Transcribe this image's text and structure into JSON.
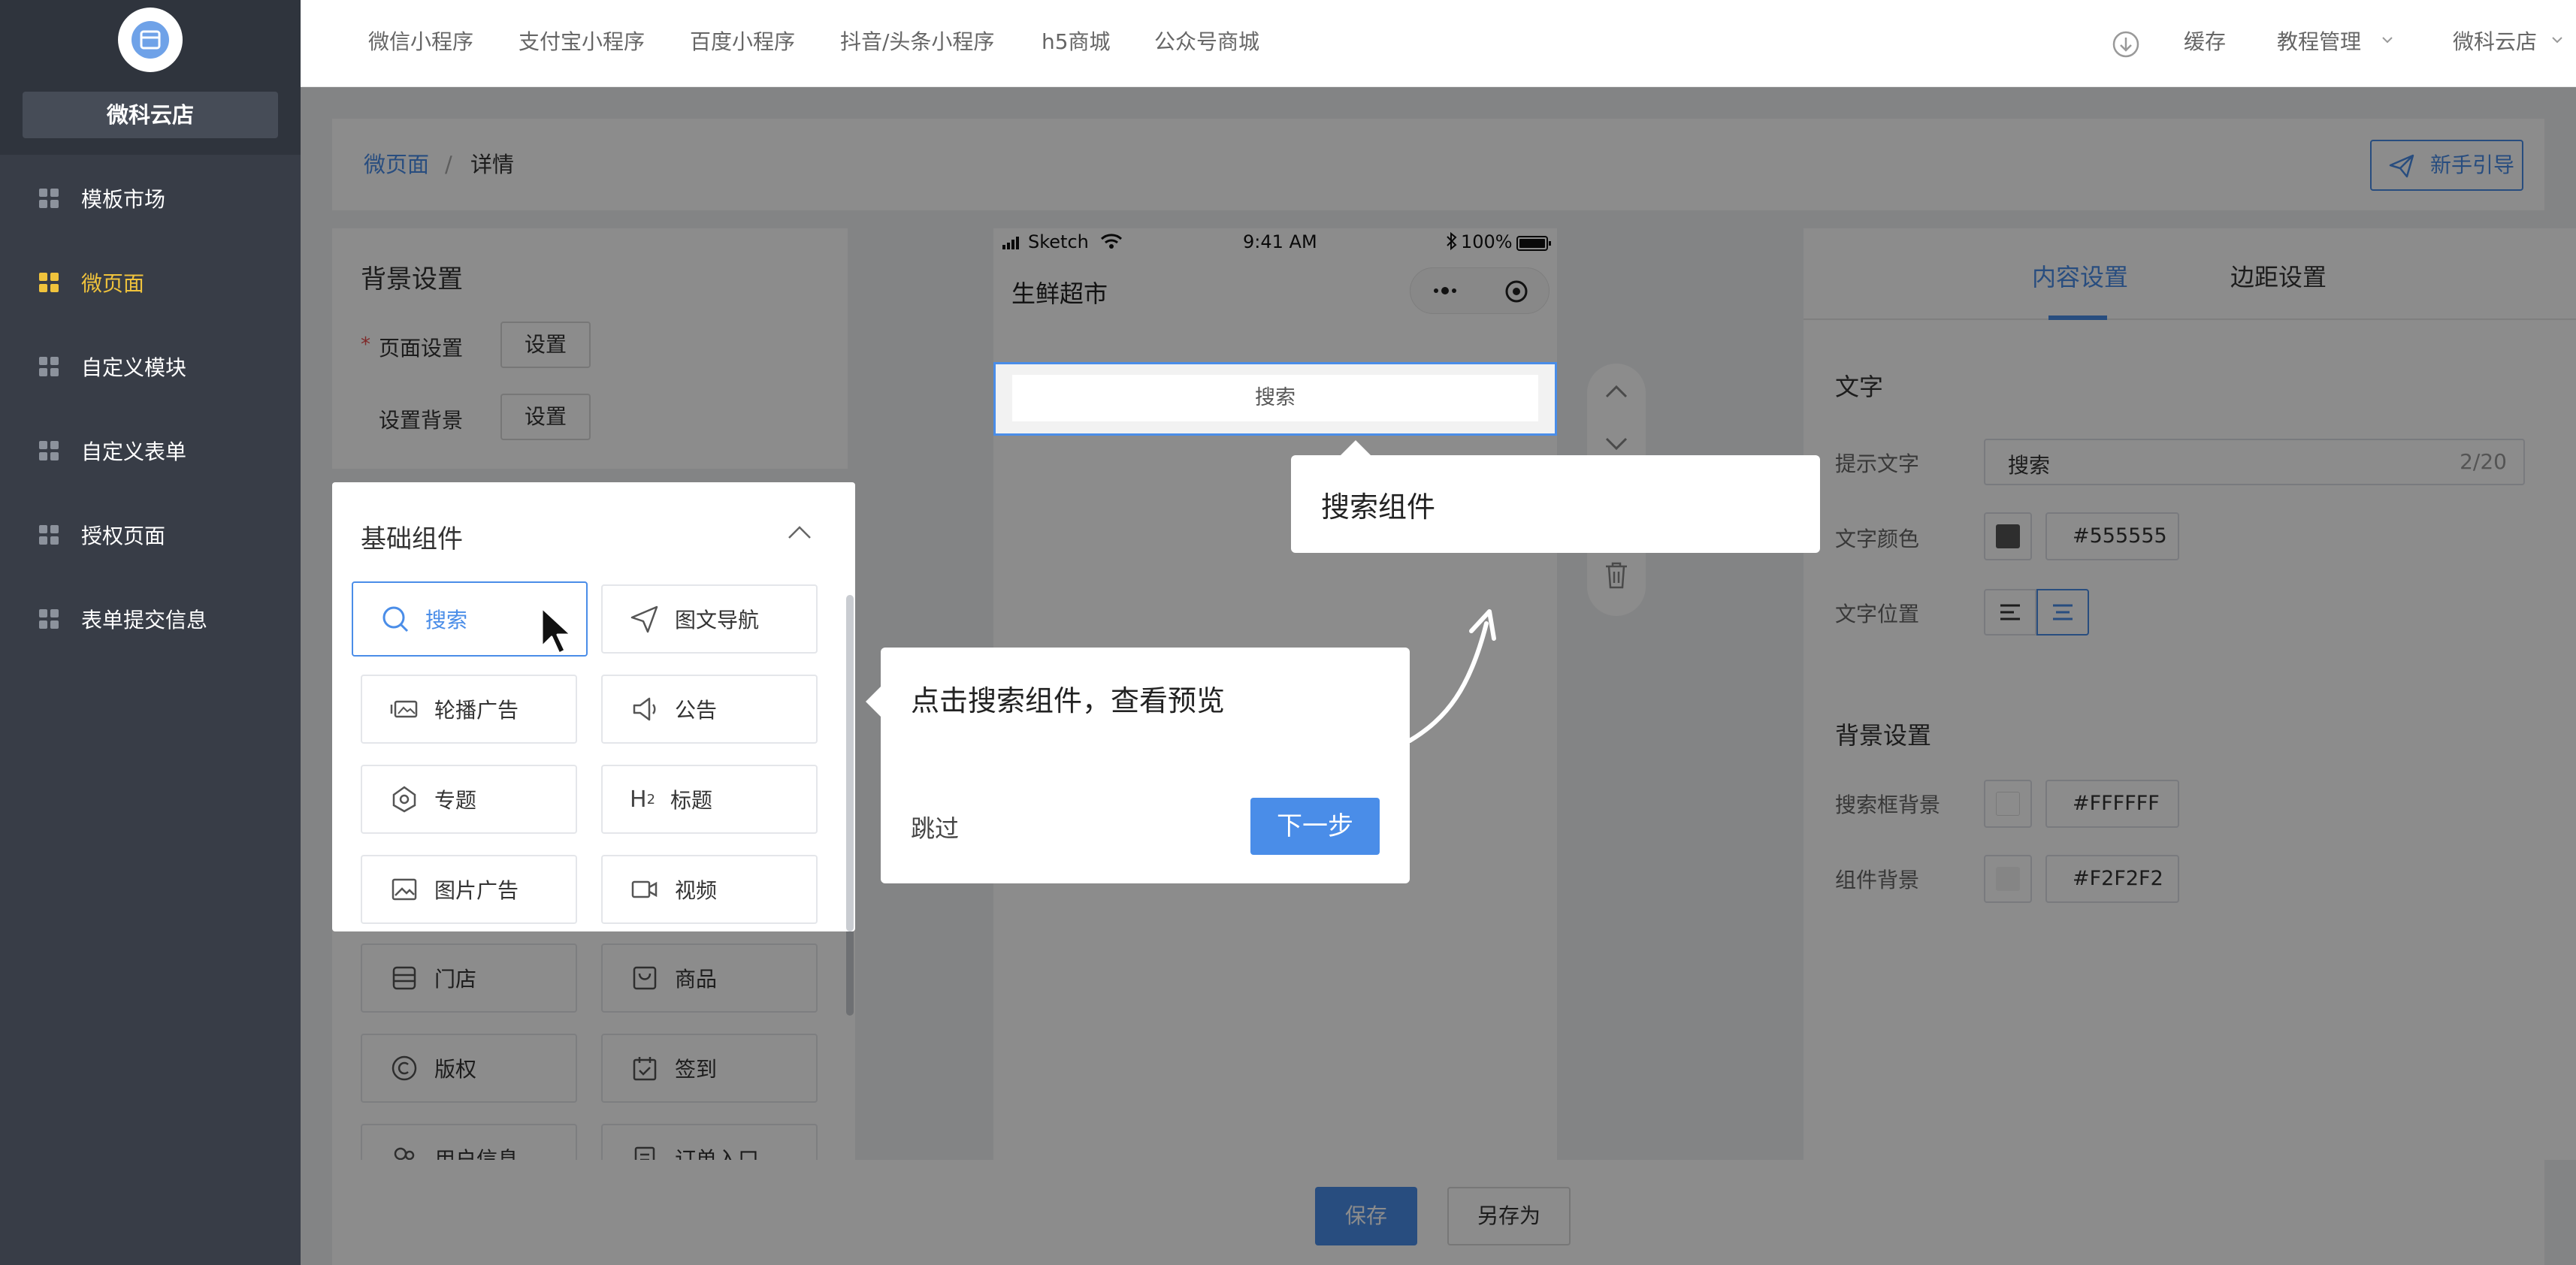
{
  "sidebar": {
    "shop_name": "微科云店",
    "items": [
      {
        "label": "模板市场"
      },
      {
        "label": "微页面"
      },
      {
        "label": "自定义模块"
      },
      {
        "label": "自定义表单"
      },
      {
        "label": "授权页面"
      },
      {
        "label": "表单提交信息"
      }
    ]
  },
  "topbar": {
    "tabs": [
      "微信小程序",
      "支付宝小程序",
      "百度小程序",
      "抖音/头条小程序",
      "h5商城",
      "公众号商城"
    ],
    "cache": "缓存",
    "tutorial": "教程管理",
    "account": "微科云店"
  },
  "breadcrumb": {
    "root": "微页面",
    "sep": "/",
    "current": "详情",
    "guide_button": "新手引导"
  },
  "bg_settings": {
    "title": "背景设置",
    "required_mark": "*",
    "page_label": "页面设置",
    "bg_label": "设置背景",
    "set_button": "设置"
  },
  "components": {
    "title": "基础组件",
    "items": [
      {
        "label": "搜索",
        "icon": "search-icon"
      },
      {
        "label": "图文导航",
        "icon": "send-icon"
      },
      {
        "label": "轮播广告",
        "icon": "carousel-icon"
      },
      {
        "label": "公告",
        "icon": "speaker-icon"
      },
      {
        "label": "专题",
        "icon": "topic-icon"
      },
      {
        "label": "标题",
        "icon": "heading-icon"
      },
      {
        "label": "图片广告",
        "icon": "image-icon"
      },
      {
        "label": "视频",
        "icon": "video-icon"
      },
      {
        "label": "门店",
        "icon": "store-icon"
      },
      {
        "label": "商品",
        "icon": "goods-icon"
      },
      {
        "label": "版权",
        "icon": "copyright-icon"
      },
      {
        "label": "签到",
        "icon": "checkin-icon"
      },
      {
        "label": "用户信息",
        "icon": "user-icon"
      },
      {
        "label": "订单入口",
        "icon": "order-icon"
      }
    ]
  },
  "phone": {
    "carrier": "Sketch",
    "time": "9:41 AM",
    "battery": "100%",
    "page_title": "生鲜超市",
    "search_placeholder": "搜索"
  },
  "tour": {
    "callout_title": "搜索组件",
    "step_text": "点击搜索组件，查看预览",
    "skip": "跳过",
    "next": "下一步"
  },
  "right_panel": {
    "tabs": [
      "内容设置",
      "边距设置"
    ],
    "text_section": "文字",
    "hint_label": "提示文字",
    "hint_value": "搜索",
    "hint_count": "2/20",
    "color_label": "文字颜色",
    "color_value": "#555555",
    "position_label": "文字位置",
    "bg_section": "背景设置",
    "search_bg_label": "搜索框背景",
    "search_bg_value": "#FFFFFF",
    "comp_bg_label": "组件背景",
    "comp_bg_value": "#F2F2F2"
  },
  "footer": {
    "save": "保存",
    "save_as": "另存为"
  },
  "colors": {
    "accent": "#4a8de8",
    "active_nav": "#f0c33c",
    "sidebar": "#383d47"
  }
}
